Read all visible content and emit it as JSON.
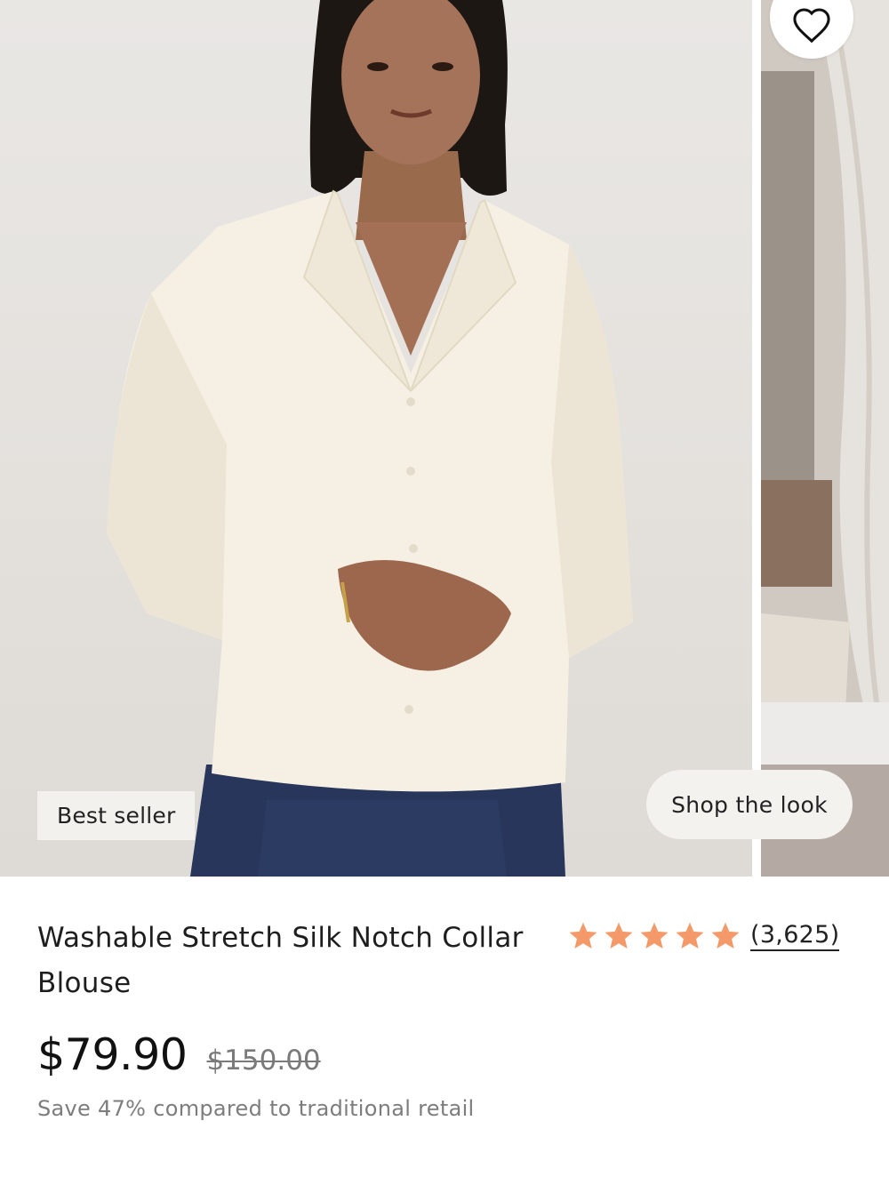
{
  "gallery": {
    "badge": "Best seller",
    "shop_the_look": "Shop the look"
  },
  "product": {
    "title": "Washable Stretch Silk Notch Collar Blouse",
    "rating": 5,
    "rating_max": 5,
    "review_count": "(3,625)",
    "price": "$79.90",
    "compare_price": "$150.00",
    "savings_text": "Save 47% compared to traditional retail"
  },
  "colors": {
    "star": "#F49A6A",
    "text": "#1E1E1E",
    "muted": "#7D7D7D"
  },
  "icons": {
    "favorite": "heart-icon",
    "star": "star-icon"
  }
}
